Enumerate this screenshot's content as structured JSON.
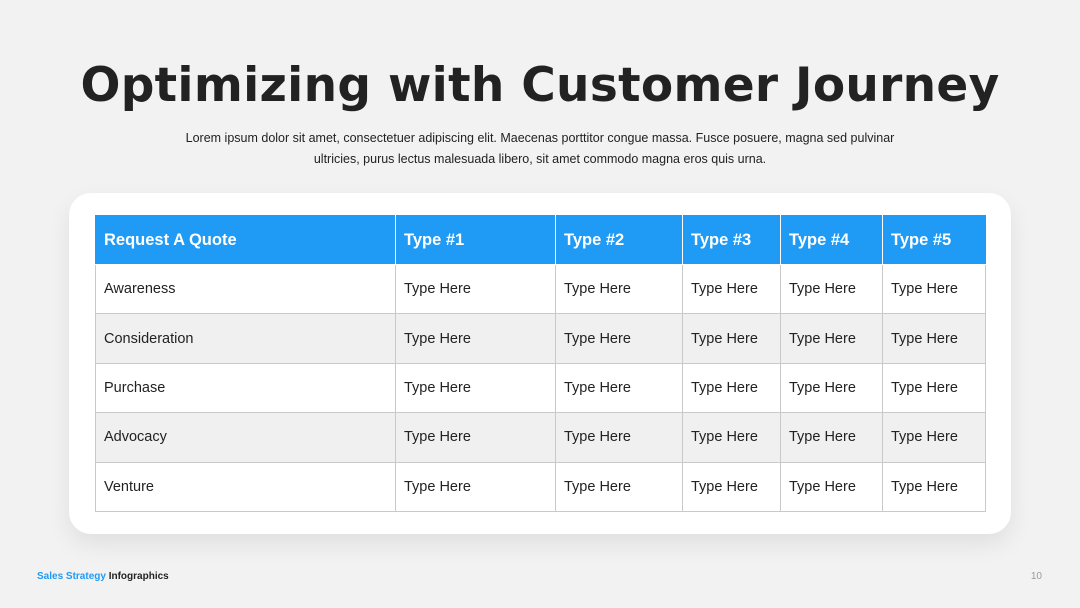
{
  "slide": {
    "title": "Optimizing with Customer Journey",
    "subtitle": "Lorem ipsum dolor sit amet, consectetuer adipiscing elit. Maecenas porttitor congue massa. Fusce posuere, magna sed pulvinar ultricies, purus lectus malesuada libero, sit amet commodo magna eros quis urna."
  },
  "table": {
    "headers": [
      "Request A Quote",
      "Type #1",
      "Type #2",
      "Type #3",
      "Type #4",
      "Type #5"
    ],
    "rows": [
      [
        "Awareness",
        "Type Here",
        "Type Here",
        "Type Here",
        "Type Here",
        "Type Here"
      ],
      [
        "Consideration",
        "Type Here",
        "Type Here",
        "Type Here",
        "Type Here",
        "Type Here"
      ],
      [
        "Purchase",
        "Type Here",
        "Type Here",
        "Type Here",
        "Type Here",
        "Type Here"
      ],
      [
        "Advocacy",
        "Type Here",
        "Type Here",
        "Type Here",
        "Type Here",
        "Type Here"
      ],
      [
        "Venture",
        "Type Here",
        "Type Here",
        "Type Here",
        "Type Here",
        "Type Here"
      ]
    ]
  },
  "footer": {
    "brand_accent": "Sales Strategy",
    "brand_main": "Infographics",
    "page_number": "10"
  },
  "colors": {
    "accent": "#1f9af5",
    "background": "#f2f2f2",
    "alt_row": "#f0f0f0",
    "text": "#222222"
  }
}
